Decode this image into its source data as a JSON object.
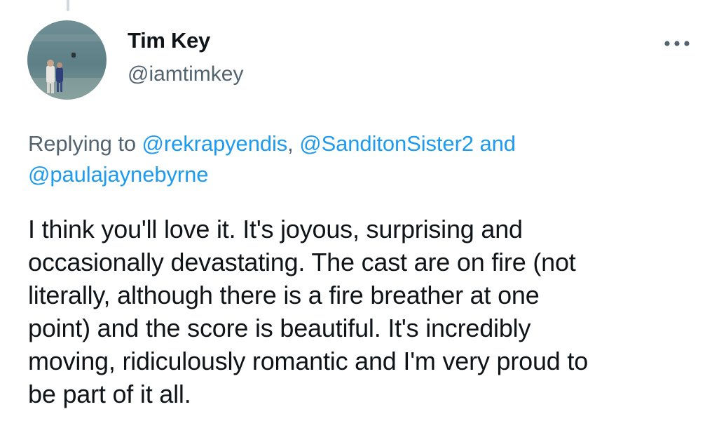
{
  "author": {
    "display_name": "Tim Key",
    "handle": "@iamtimkey"
  },
  "menu": {
    "icon": "more-horizontal-icon"
  },
  "reply_context": {
    "prefix": "Replying to ",
    "mentions": [
      "@rekrapyendis",
      "@SanditonSister2",
      "@paulajaynebyrne"
    ],
    "separator": ", ",
    "conjunction": " and "
  },
  "tweet": {
    "text": "I think you'll love it. It's joyous, surprising and\noccasionally devastating. The cast are on fire (not\nliterally, although there is a fire breather at one\npoint) and the score is beautiful. It's incredibly\nmoving, ridiculously romantic and I'm very proud to\nbe part of it all."
  },
  "colors": {
    "text_primary": "#0f1419",
    "text_secondary": "#536471",
    "link": "#1d9bf0",
    "thread_line": "#cfd9de"
  }
}
